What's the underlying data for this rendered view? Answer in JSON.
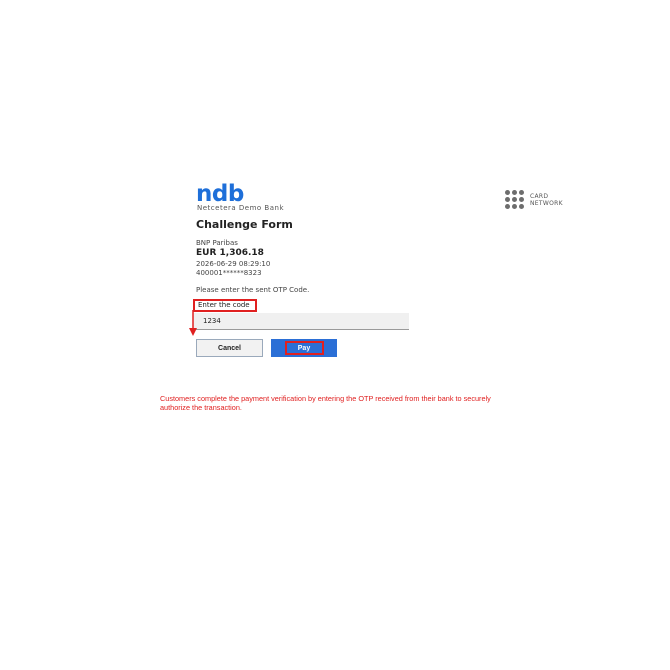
{
  "header": {
    "logo_text": "ndb",
    "bank_name": "Netcetera Demo Bank",
    "network_line1": "CARD",
    "network_line2": "NETWORK"
  },
  "form": {
    "title": "Challenge Form",
    "merchant": "BNP Paribas",
    "amount": "EUR 1,306.18",
    "date": "2026-06-29 08:29:10",
    "card_number": "400001******8323",
    "instruction": "Please enter the sent OTP Code.",
    "code_label": "Enter the code",
    "code_value": "1234",
    "cancel_label": "Cancel",
    "pay_label": "Pay"
  },
  "annotation": {
    "caption": "Customers complete the payment verification by entering the OTP received from their bank to securely authorize the transaction.",
    "highlight_color": "#e02020"
  },
  "colors": {
    "brand_blue": "#1e6fd9",
    "pay_button": "#2b6fd6"
  },
  "icons": {
    "network_logo": "card-network-dots-icon"
  }
}
